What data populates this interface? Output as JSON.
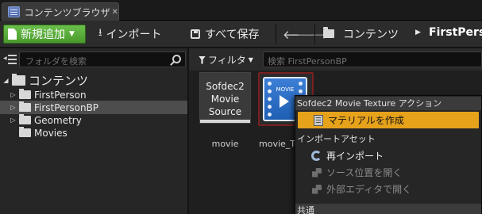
{
  "tab": {
    "title": "コンテンツブラウザ",
    "close": "✕"
  },
  "toolbar": {
    "add_new_label": "新規追加",
    "import_label": "インポート",
    "save_all_label": "すべて保存"
  },
  "breadcrumb": {
    "root": "コンテンツ",
    "current": "FirstPerson"
  },
  "sidebar": {
    "search_placeholder": "フォルダを検索",
    "tree": [
      {
        "label": "コンテンツ",
        "expanded": true,
        "selected": false
      },
      {
        "label": "FirstPerson",
        "expanded": false,
        "selected": false
      },
      {
        "label": "FirstPersonBP",
        "expanded": false,
        "selected": true
      },
      {
        "label": "Geometry",
        "expanded": false,
        "selected": false
      },
      {
        "label": "Movies",
        "expanded": false,
        "selected": false
      }
    ]
  },
  "content": {
    "filter_label": "フィルタ",
    "search_placeholder": "検索 FirstPersonBP",
    "assets": [
      {
        "thumb_text": "Sofdec2\nMovie\nSource",
        "label": "movie"
      },
      {
        "thumb_text": "MOVIE",
        "label": "movie_Te"
      }
    ]
  },
  "context_menu": {
    "section1": "Sofdec2 Movie Texture アクション",
    "create_material": "マテリアルを作成",
    "section2": "インポートアセット",
    "reimport": "再インポート",
    "open_source_location": "ソース位置を開く",
    "open_external_editor": "外部エディタで開く",
    "section3": "共通"
  },
  "colors": {
    "accent": "#e6a21b",
    "add_button": "#5aa93a",
    "selected_row": "#4d4d4d"
  }
}
